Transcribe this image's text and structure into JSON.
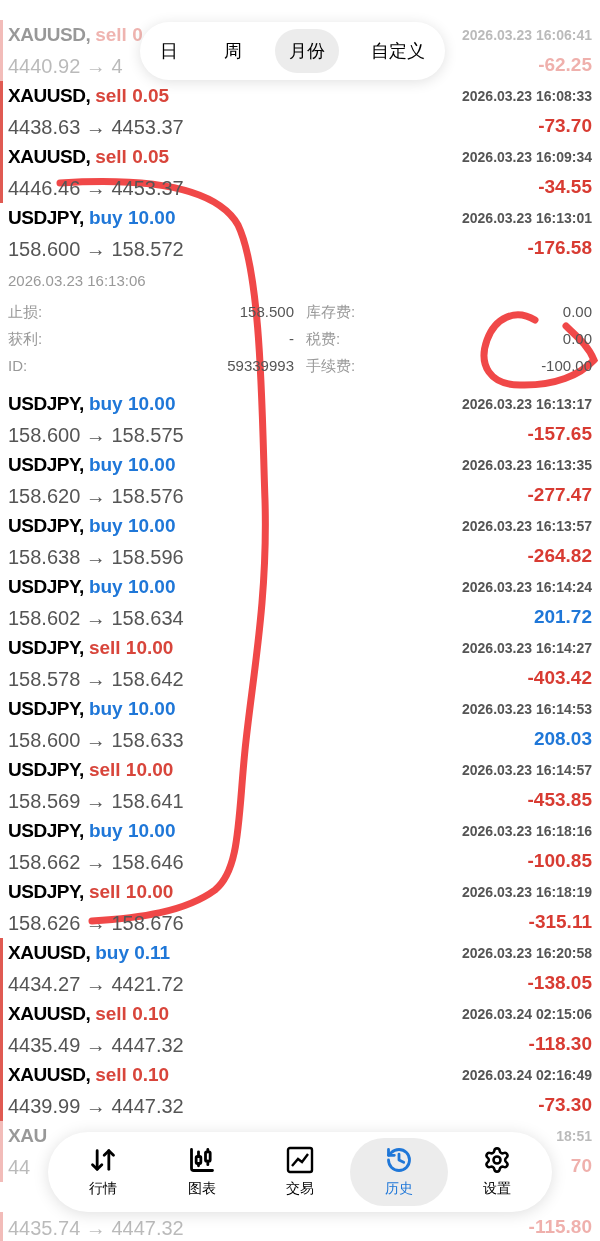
{
  "period_tabs": [
    {
      "label": "日",
      "selected": false
    },
    {
      "label": "周",
      "selected": false
    },
    {
      "label": "月份",
      "selected": true
    },
    {
      "label": "自定义",
      "selected": false
    }
  ],
  "rows": [
    {
      "dim": true,
      "marked": true,
      "symbol": "XAUUSD,",
      "is_buy": false,
      "side_text": "sell 0",
      "time": "2026.03.23 16:06:41",
      "prices": "4440.92 → 4",
      "profit": "-62.25",
      "gain": false
    },
    {
      "dim": false,
      "marked": true,
      "symbol": "XAUUSD,",
      "is_buy": false,
      "side_text": "sell 0.05",
      "time": "2026.03.23 16:08:33",
      "prices": "4438.63 → 4453.37",
      "profit": "-73.70",
      "gain": false
    },
    {
      "dim": false,
      "marked": true,
      "symbol": "XAUUSD,",
      "is_buy": false,
      "side_text": "sell 0.05",
      "time": "2026.03.23 16:09:34",
      "prices": "4446.46 → 4453.37",
      "profit": "-34.55",
      "gain": false
    },
    {
      "dim": false,
      "marked": false,
      "symbol": "USDJPY,",
      "is_buy": true,
      "side_text": "buy 10.00",
      "time": "2026.03.23 16:13:01",
      "prices": "158.600 → 158.572",
      "profit": "-176.58",
      "gain": false,
      "details": {
        "time": "2026.03.23 16:13:06",
        "left": [
          {
            "label": "止损:",
            "value": "158.500"
          },
          {
            "label": "获利:",
            "value": "-"
          },
          {
            "label": "ID:",
            "value": "59339993"
          }
        ],
        "right": [
          {
            "label": "库存费:",
            "value": "0.00"
          },
          {
            "label": "税费:",
            "value": "0.00"
          },
          {
            "label": "手续费:",
            "value": "-100.00"
          }
        ]
      }
    },
    {
      "dim": false,
      "marked": false,
      "symbol": "USDJPY,",
      "is_buy": true,
      "side_text": "buy 10.00",
      "time": "2026.03.23 16:13:17",
      "prices": "158.600 → 158.575",
      "profit": "-157.65",
      "gain": false
    },
    {
      "dim": false,
      "marked": false,
      "symbol": "USDJPY,",
      "is_buy": true,
      "side_text": "buy 10.00",
      "time": "2026.03.23 16:13:35",
      "prices": "158.620 → 158.576",
      "profit": "-277.47",
      "gain": false
    },
    {
      "dim": false,
      "marked": false,
      "symbol": "USDJPY,",
      "is_buy": true,
      "side_text": "buy 10.00",
      "time": "2026.03.23 16:13:57",
      "prices": "158.638 → 158.596",
      "profit": "-264.82",
      "gain": false
    },
    {
      "dim": false,
      "marked": false,
      "symbol": "USDJPY,",
      "is_buy": true,
      "side_text": "buy 10.00",
      "time": "2026.03.23 16:14:24",
      "prices": "158.602 → 158.634",
      "profit": "201.72",
      "gain": true
    },
    {
      "dim": false,
      "marked": false,
      "symbol": "USDJPY,",
      "is_buy": false,
      "side_text": "sell 10.00",
      "time": "2026.03.23 16:14:27",
      "prices": "158.578 → 158.642",
      "profit": "-403.42",
      "gain": false
    },
    {
      "dim": false,
      "marked": false,
      "symbol": "USDJPY,",
      "is_buy": true,
      "side_text": "buy 10.00",
      "time": "2026.03.23 16:14:53",
      "prices": "158.600 → 158.633",
      "profit": "208.03",
      "gain": true
    },
    {
      "dim": false,
      "marked": false,
      "symbol": "USDJPY,",
      "is_buy": false,
      "side_text": "sell 10.00",
      "time": "2026.03.23 16:14:57",
      "prices": "158.569 → 158.641",
      "profit": "-453.85",
      "gain": false
    },
    {
      "dim": false,
      "marked": false,
      "symbol": "USDJPY,",
      "is_buy": true,
      "side_text": "buy 10.00",
      "time": "2026.03.23 16:18:16",
      "prices": "158.662 → 158.646",
      "profit": "-100.85",
      "gain": false
    },
    {
      "dim": false,
      "marked": false,
      "symbol": "USDJPY,",
      "is_buy": false,
      "side_text": "sell 10.00",
      "time": "2026.03.23 16:18:19",
      "prices": "158.626 → 158.676",
      "profit": "-315.11",
      "gain": false
    },
    {
      "dim": false,
      "marked": true,
      "symbol": "XAUUSD,",
      "is_buy": true,
      "side_text": "buy 0.11",
      "time": "2026.03.23 16:20:58",
      "prices": "4434.27 → 4421.72",
      "profit": "-138.05",
      "gain": false
    },
    {
      "dim": false,
      "marked": true,
      "symbol": "XAUUSD,",
      "is_buy": false,
      "side_text": "sell 0.10",
      "time": "2026.03.24 02:15:06",
      "prices": "4435.49 → 4447.32",
      "profit": "-118.30",
      "gain": false
    },
    {
      "dim": false,
      "marked": true,
      "symbol": "XAUUSD,",
      "is_buy": false,
      "side_text": "sell 0.10",
      "time": "2026.03.24 02:16:49",
      "prices": "4439.99 → 4447.32",
      "profit": "-73.30",
      "gain": false
    },
    {
      "dim": true,
      "marked": true,
      "symbol": "XAU",
      "time": "18:51",
      "prices": "44",
      "profit": "70",
      "gain": false
    },
    {
      "dim": true,
      "marked": true,
      "prices": "4435.74 → 4447.32",
      "profit": "-115.80",
      "gain": false
    }
  ],
  "nav": [
    {
      "kind": "quotes",
      "label": "行情",
      "selected": false
    },
    {
      "kind": "chart",
      "label": "图表",
      "selected": false
    },
    {
      "kind": "trade",
      "label": "交易",
      "selected": false
    },
    {
      "kind": "history",
      "label": "历史",
      "selected": true
    },
    {
      "kind": "settings",
      "label": "设置",
      "selected": false
    }
  ]
}
